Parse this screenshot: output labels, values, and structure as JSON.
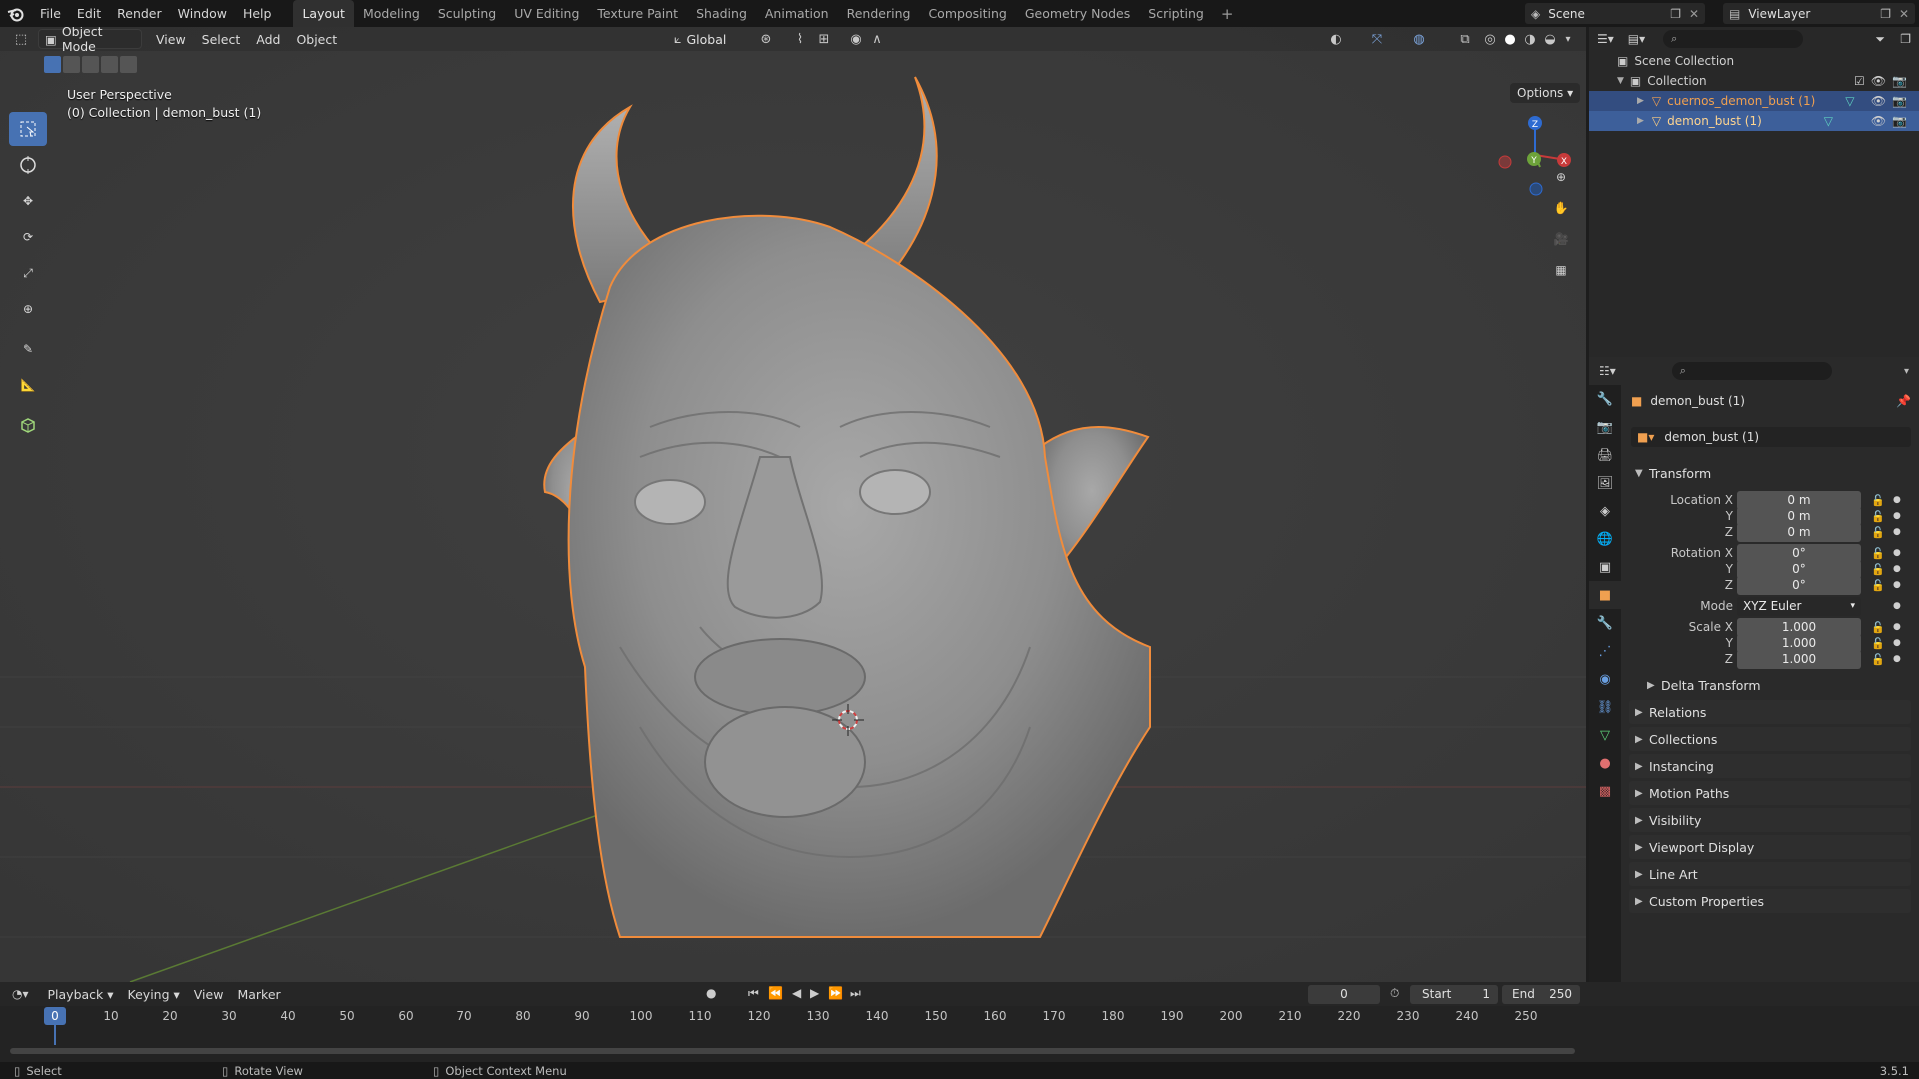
{
  "topbar": {
    "menus": [
      "File",
      "Edit",
      "Render",
      "Window",
      "Help"
    ],
    "workspaces": [
      "Layout",
      "Modeling",
      "Sculpting",
      "UV Editing",
      "Texture Paint",
      "Shading",
      "Animation",
      "Rendering",
      "Compositing",
      "Geometry Nodes",
      "Scripting"
    ],
    "active_workspace": "Layout",
    "scene": "Scene",
    "view_layer": "ViewLayer"
  },
  "viewport": {
    "mode": "Object Mode",
    "menus": [
      "View",
      "Select",
      "Add",
      "Object"
    ],
    "orientation": "Global",
    "options": "Options",
    "info_line1": "User Perspective",
    "info_line2": "(0) Collection | demon_bust (1)"
  },
  "outliner": {
    "scene_collection": "Scene Collection",
    "collection": "Collection",
    "objects": [
      "cuernos_demon_bust (1)",
      "demon_bust (1)"
    ]
  },
  "properties": {
    "object_name": "demon_bust (1)",
    "datablock_name": "demon_bust (1)",
    "transform_title": "Transform",
    "location_label": "Location X",
    "location": [
      "0 m",
      "0 m",
      "0 m"
    ],
    "rotation_label": "Rotation X",
    "rotation": [
      "0°",
      "0°",
      "0°"
    ],
    "mode_label": "Mode",
    "mode_value": "XYZ Euler",
    "scale_label": "Scale X",
    "scale": [
      "1.000",
      "1.000",
      "1.000"
    ],
    "axis_y": "Y",
    "axis_z": "Z",
    "subpanels": [
      "Delta Transform",
      "Relations",
      "Collections",
      "Instancing",
      "Motion Paths",
      "Visibility",
      "Viewport Display",
      "Line Art",
      "Custom Properties"
    ]
  },
  "timeline": {
    "menus": [
      "Playback",
      "Keying",
      "View",
      "Marker"
    ],
    "current_frame": "0",
    "start_label": "Start",
    "start": "1",
    "end_label": "End",
    "end": "250",
    "ticks": [
      "0",
      "10",
      "20",
      "30",
      "40",
      "50",
      "60",
      "70",
      "80",
      "90",
      "100",
      "110",
      "120",
      "130",
      "140",
      "150",
      "160",
      "170",
      "180",
      "190",
      "200",
      "210",
      "220",
      "230",
      "240",
      "250"
    ]
  },
  "statusbar": {
    "select": "Select",
    "rotate": "Rotate View",
    "context": "Object Context Menu",
    "version": "3.5.1"
  },
  "colors": {
    "accent": "#4772b3",
    "selection_outline": "#f08c3c",
    "viewport_bg": "#3a3a3a"
  }
}
